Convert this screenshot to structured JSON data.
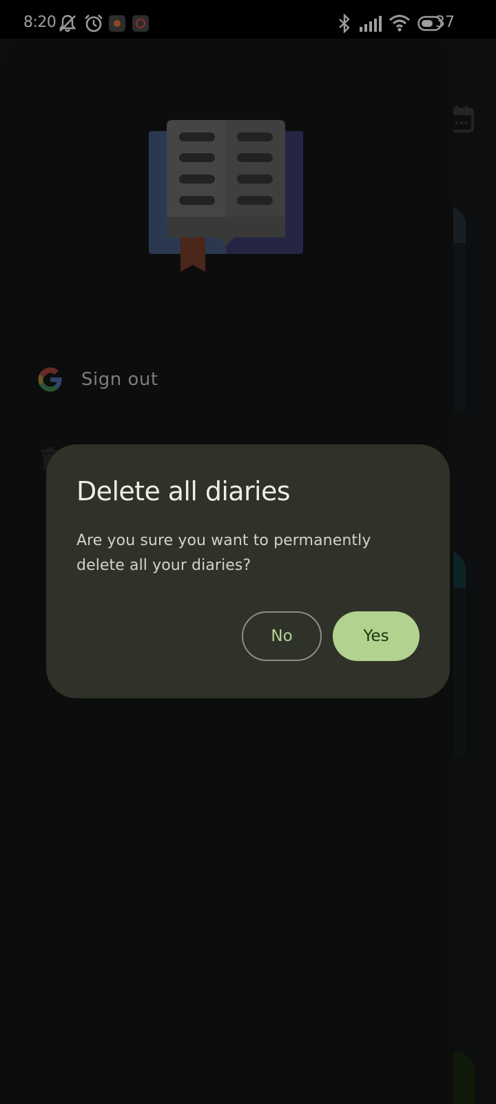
{
  "status_bar": {
    "time": "8:20",
    "battery_percent": "37",
    "icons": [
      "mute-icon",
      "alarm-icon",
      "app-notification-icon",
      "call-notification-icon",
      "bluetooth-icon",
      "signal-icon",
      "wifi-icon",
      "battery-icon"
    ]
  },
  "drawer": {
    "logo": "open-book-icon",
    "items": [
      {
        "label": "Sign out",
        "icon": "google-icon"
      },
      {
        "label": "",
        "icon": "trash-icon"
      }
    ]
  },
  "dialog": {
    "title": "Delete all diaries",
    "message": "Are you sure you want to permanently delete all your diaries?",
    "negative_label": "No",
    "positive_label": "Yes"
  },
  "colors": {
    "dialog_bg": "#2e3229",
    "primary": "#b2d28f",
    "on_primary": "#1e3511",
    "drawer_bg": "#141515"
  }
}
